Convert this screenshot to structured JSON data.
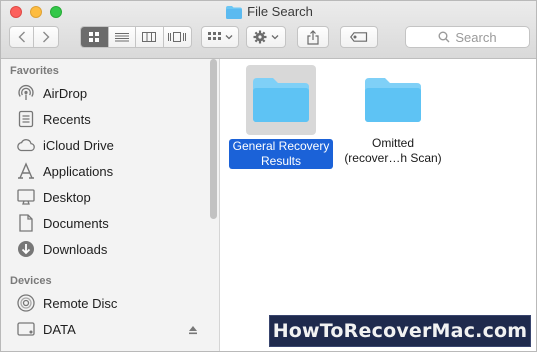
{
  "window": {
    "title": "File Search"
  },
  "toolbar": {
    "back_icon": "chevron-left-icon",
    "forward_icon": "chevron-right-icon",
    "view_modes": [
      "icon-view-icon",
      "list-view-icon",
      "column-view-icon",
      "cover-flow-icon"
    ],
    "active_view": "icon-view-icon",
    "arrange_icon": "arrange-grid-icon",
    "action_icon": "gear-icon",
    "share_icon": "share-icon",
    "tags_icon": "tag-icon",
    "search_placeholder": "Search"
  },
  "sidebar": {
    "favorites_header": "Favorites",
    "favorites": [
      {
        "label": "AirDrop",
        "icon": "airdrop-icon"
      },
      {
        "label": "Recents",
        "icon": "recents-icon"
      },
      {
        "label": "iCloud Drive",
        "icon": "cloud-icon"
      },
      {
        "label": "Applications",
        "icon": "applications-icon"
      },
      {
        "label": "Desktop",
        "icon": "desktop-icon"
      },
      {
        "label": "Documents",
        "icon": "documents-icon"
      },
      {
        "label": "Downloads",
        "icon": "downloads-icon"
      }
    ],
    "devices_header": "Devices",
    "devices": [
      {
        "label": "Remote Disc",
        "icon": "disc-icon"
      },
      {
        "label": "DATA",
        "icon": "drive-icon"
      }
    ]
  },
  "files": [
    {
      "name_line1": "General Recovery",
      "name_line2": "Results",
      "selected": true
    },
    {
      "name_line1": "Omitted",
      "name_line2": "(recover…h Scan)",
      "selected": false
    }
  ],
  "watermark": "HowToRecoverMac.com",
  "colors": {
    "selection": "#1b62d8",
    "folder": "#5ec3f4"
  }
}
